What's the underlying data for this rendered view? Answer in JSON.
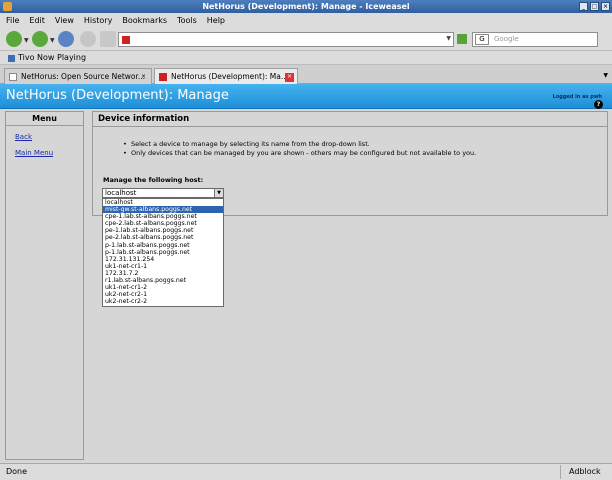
{
  "window": {
    "title": "NetHorus (Development): Manage - Iceweasel"
  },
  "menubar": {
    "items": [
      "File",
      "Edit",
      "View",
      "History",
      "Bookmarks",
      "Tools",
      "Help"
    ]
  },
  "navbar": {
    "url_value": "",
    "search_placeholder": "Google"
  },
  "bookmarks": {
    "items": [
      "Tivo Now Playing"
    ]
  },
  "tabs": [
    {
      "label": "NetHorus: Open Source Networ...",
      "active": false
    },
    {
      "label": "NetHorus (Development): Ma...",
      "active": true
    }
  ],
  "page": {
    "title": "NetHorus (Development): Manage",
    "login_text": "Logged in as pwh",
    "help_label": "?"
  },
  "sidebar": {
    "heading": "Menu",
    "links": [
      "Back",
      "Main Menu"
    ]
  },
  "main": {
    "heading": "Device information",
    "bullets": [
      "Select a device to manage by selecting its name from the drop-down list.",
      "Only devices that can be managed by you are shown - others may be configured but not available to you."
    ],
    "manage_label": "Manage the following host:",
    "selected_host": "localhost",
    "highlighted_option_index": 1,
    "host_options": [
      "localhost",
      "mist-gw.st-albans.poggs.net",
      "cpe-1.lab.st-albans.poggs.net",
      "cpe-2.lab.st-albans.poggs.net",
      "pe-1.lab.st-albans.poggs.net",
      "pe-2.lab.st-albans.poggs.net",
      "p-1.lab.st-albans.poggs.net",
      "p-1.lab.st-albans.poggs.net",
      "172.31.131.254",
      "uk1-net-cr1-1",
      "172.31.7.2",
      "r1.lab.st-albans.poggs.net",
      "uk1-net-cr1-2",
      "uk2-net-cr2-1",
      "uk2-net-cr2-2"
    ]
  },
  "statusbar": {
    "text": "Done",
    "adblock_label": "Adblock"
  },
  "colors": {
    "header_blue": "#1d8fd8",
    "selection_blue": "#2e63ae",
    "link_blue": "#1a2aa8"
  }
}
